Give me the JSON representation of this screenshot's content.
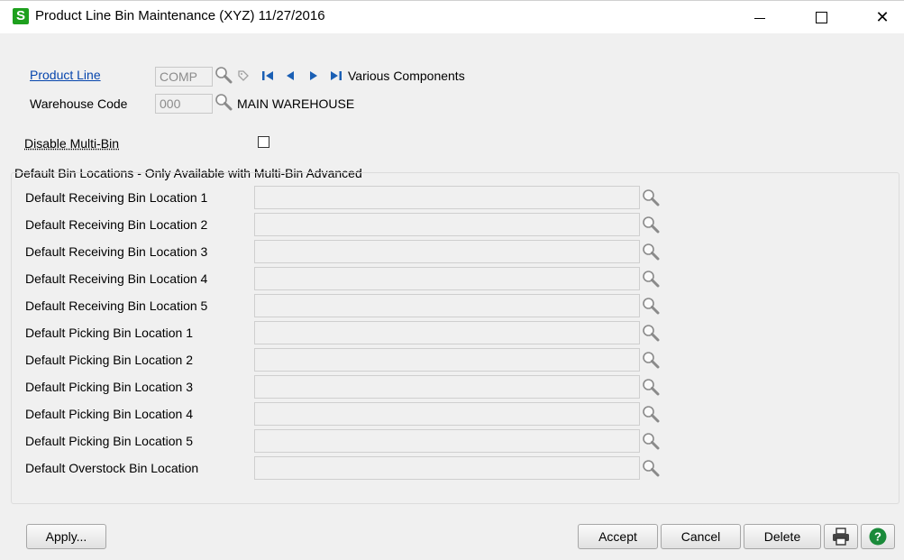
{
  "window": {
    "app_icon_letter": "S",
    "title": "Product Line Bin Maintenance (XYZ) 11/27/2016",
    "controls": [
      "minimize-icon",
      "maximize-icon",
      "close-icon"
    ]
  },
  "header": {
    "product_line_label": "Product Line",
    "product_line_value": "COMP",
    "product_line_description": "Various Components",
    "warehouse_label": "Warehouse Code",
    "warehouse_value": "000",
    "warehouse_description": "MAIN WAREHOUSE"
  },
  "disable_multi_bin": {
    "label": "Disable Multi-Bin",
    "checked": false
  },
  "bins": {
    "group_title": "Default Bin Locations - Only Available with Multi-Bin Advanced",
    "rows": [
      {
        "label": "Default Receiving Bin Location 1",
        "value": ""
      },
      {
        "label": "Default Receiving Bin Location 2",
        "value": ""
      },
      {
        "label": "Default Receiving Bin Location 3",
        "value": ""
      },
      {
        "label": "Default Receiving Bin Location 4",
        "value": ""
      },
      {
        "label": "Default Receiving Bin Location 5",
        "value": ""
      },
      {
        "label": "Default Picking Bin Location 1",
        "value": ""
      },
      {
        "label": "Default Picking Bin Location 2",
        "value": ""
      },
      {
        "label": "Default Picking Bin Location 3",
        "value": ""
      },
      {
        "label": "Default Picking Bin Location 4",
        "value": ""
      },
      {
        "label": "Default Picking Bin Location 5",
        "value": ""
      },
      {
        "label": "Default Overstock Bin Location",
        "value": ""
      }
    ]
  },
  "buttons": {
    "apply": "Apply...",
    "accept": "Accept",
    "cancel": "Cancel",
    "delete": "Delete"
  },
  "colors": {
    "app_icon": "#1ea01e",
    "link": "#0645ad",
    "nav_arrows": "#1a5fb4",
    "help": "#1a8a3a"
  }
}
